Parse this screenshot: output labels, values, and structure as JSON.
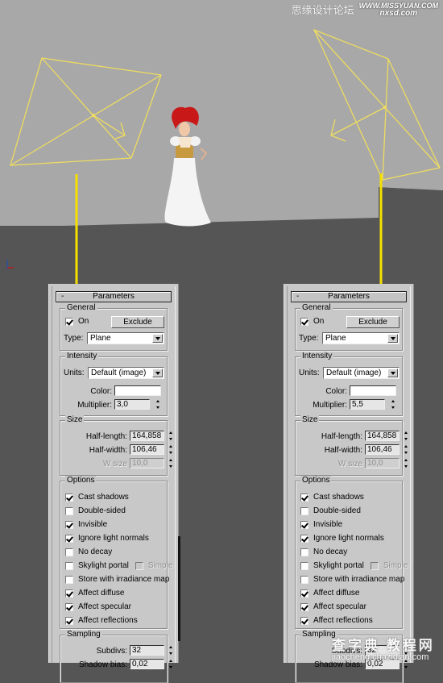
{
  "watermark_top": {
    "site_name": "思缘设计论坛",
    "logo_line1": "WWW.MISSYUAN.COM",
    "logo_line2": "nxsd.com"
  },
  "watermark_bottom": {
    "site_name": "查字典 教程网",
    "url": "jiaocheng.chazidian.com"
  },
  "scene": {
    "wireframe_color": "#f0e060",
    "target_line_color": "#f5e000",
    "wall_color": "#a8a8a8",
    "floor_color": "#555555"
  },
  "panels": [
    {
      "id": "left",
      "rollout_title": "Parameters",
      "rollout_toggle": "-",
      "general": {
        "title": "General",
        "on_label": "On",
        "on_checked": true,
        "exclude_label": "Exclude",
        "type_label": "Type:",
        "type_value": "Plane"
      },
      "intensity": {
        "title": "Intensity",
        "units_label": "Units:",
        "units_value": "Default (image)",
        "color_label": "Color:",
        "color_value": "#ffffff",
        "multiplier_label": "Multiplier:",
        "multiplier_value": "3,0"
      },
      "size": {
        "title": "Size",
        "half_length_label": "Half-length:",
        "half_length_value": "164,858",
        "half_width_label": "Half-width:",
        "half_width_value": "106,46",
        "w_size_label": "W size",
        "w_size_value": "10,0"
      },
      "options": {
        "title": "Options",
        "items": [
          {
            "label": "Cast shadows",
            "checked": true
          },
          {
            "label": "Double-sided",
            "checked": false
          },
          {
            "label": "Invisible",
            "checked": true
          },
          {
            "label": "Ignore light normals",
            "checked": true
          },
          {
            "label": "No decay",
            "checked": false
          },
          {
            "label": "Skylight portal",
            "checked": false
          },
          {
            "label": "Store with irradiance map",
            "checked": false
          },
          {
            "label": "Affect diffuse",
            "checked": true
          },
          {
            "label": "Affect specular",
            "checked": true
          },
          {
            "label": "Affect reflections",
            "checked": true
          }
        ],
        "simple_label": "Simple",
        "simple_checked": false
      },
      "sampling": {
        "title": "Sampling",
        "subdivs_label": "Subdivs:",
        "subdivs_value": "32",
        "shadow_bias_label": "Shadow bias:",
        "shadow_bias_value": "0,02"
      }
    },
    {
      "id": "right",
      "rollout_title": "Parameters",
      "rollout_toggle": "-",
      "general": {
        "title": "General",
        "on_label": "On",
        "on_checked": true,
        "exclude_label": "Exclude",
        "type_label": "Type:",
        "type_value": "Plane"
      },
      "intensity": {
        "title": "Intensity",
        "units_label": "Units:",
        "units_value": "Default (image)",
        "color_label": "Color:",
        "color_value": "#ffffff",
        "multiplier_label": "Multiplier:",
        "multiplier_value": "5,5"
      },
      "size": {
        "title": "Size",
        "half_length_label": "Half-length:",
        "half_length_value": "164,858",
        "half_width_label": "Half-width:",
        "half_width_value": "106,46",
        "w_size_label": "W size",
        "w_size_value": "10,0"
      },
      "options": {
        "title": "Options",
        "items": [
          {
            "label": "Cast shadows",
            "checked": true
          },
          {
            "label": "Double-sided",
            "checked": false
          },
          {
            "label": "Invisible",
            "checked": true
          },
          {
            "label": "Ignore light normals",
            "checked": true
          },
          {
            "label": "No decay",
            "checked": false
          },
          {
            "label": "Skylight portal",
            "checked": false
          },
          {
            "label": "Store with irradiance map",
            "checked": false
          },
          {
            "label": "Affect diffuse",
            "checked": true
          },
          {
            "label": "Affect specular",
            "checked": true
          },
          {
            "label": "Affect reflections",
            "checked": true
          }
        ],
        "simple_label": "Simple",
        "simple_checked": false
      },
      "sampling": {
        "title": "Sampling",
        "subdivs_label": "Subdivs:",
        "subdivs_value": "32",
        "shadow_bias_label": "Shadow bias:",
        "shadow_bias_value": "0,02"
      }
    }
  ]
}
